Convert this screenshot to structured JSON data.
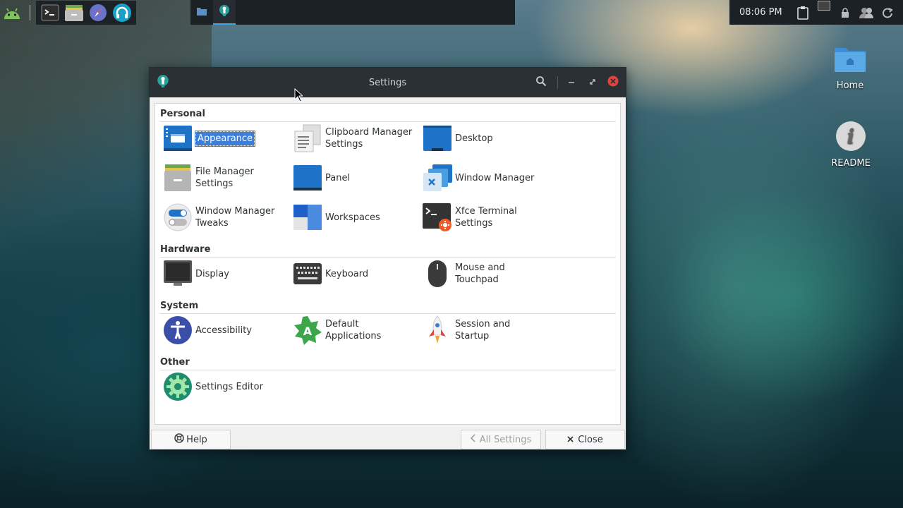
{
  "panel": {
    "clock": "08:06 PM",
    "launchers": [
      "terminal-icon",
      "file-manager-icon",
      "web-browser-icon",
      "headphones-icon"
    ]
  },
  "desktop": {
    "icons": [
      {
        "label": "Home"
      },
      {
        "label": "README"
      }
    ]
  },
  "window": {
    "title": "Settings",
    "sections": [
      {
        "title": "Personal",
        "items": [
          {
            "label": "Appearance",
            "selected": true
          },
          {
            "label": "Clipboard Manager\nSettings"
          },
          {
            "label": "Desktop"
          },
          {
            "label": "File Manager\nSettings"
          },
          {
            "label": "Panel"
          },
          {
            "label": "Window Manager"
          },
          {
            "label": "Window Manager\nTweaks"
          },
          {
            "label": "Workspaces"
          },
          {
            "label": "Xfce Terminal\nSettings"
          }
        ]
      },
      {
        "title": "Hardware",
        "items": [
          {
            "label": "Display"
          },
          {
            "label": "Keyboard"
          },
          {
            "label": "Mouse and\nTouchpad"
          }
        ]
      },
      {
        "title": "System",
        "items": [
          {
            "label": "Accessibility"
          },
          {
            "label": "Default\nApplications"
          },
          {
            "label": "Session and\nStartup"
          }
        ]
      },
      {
        "title": "Other",
        "items": [
          {
            "label": "Settings Editor"
          }
        ]
      }
    ],
    "footer": {
      "help": "Help",
      "all_settings": "All Settings",
      "close": "Close"
    }
  },
  "colors": {
    "accent": "#3d7ed6",
    "titlebar": "#2b3034",
    "close_button": "#e0443e"
  }
}
